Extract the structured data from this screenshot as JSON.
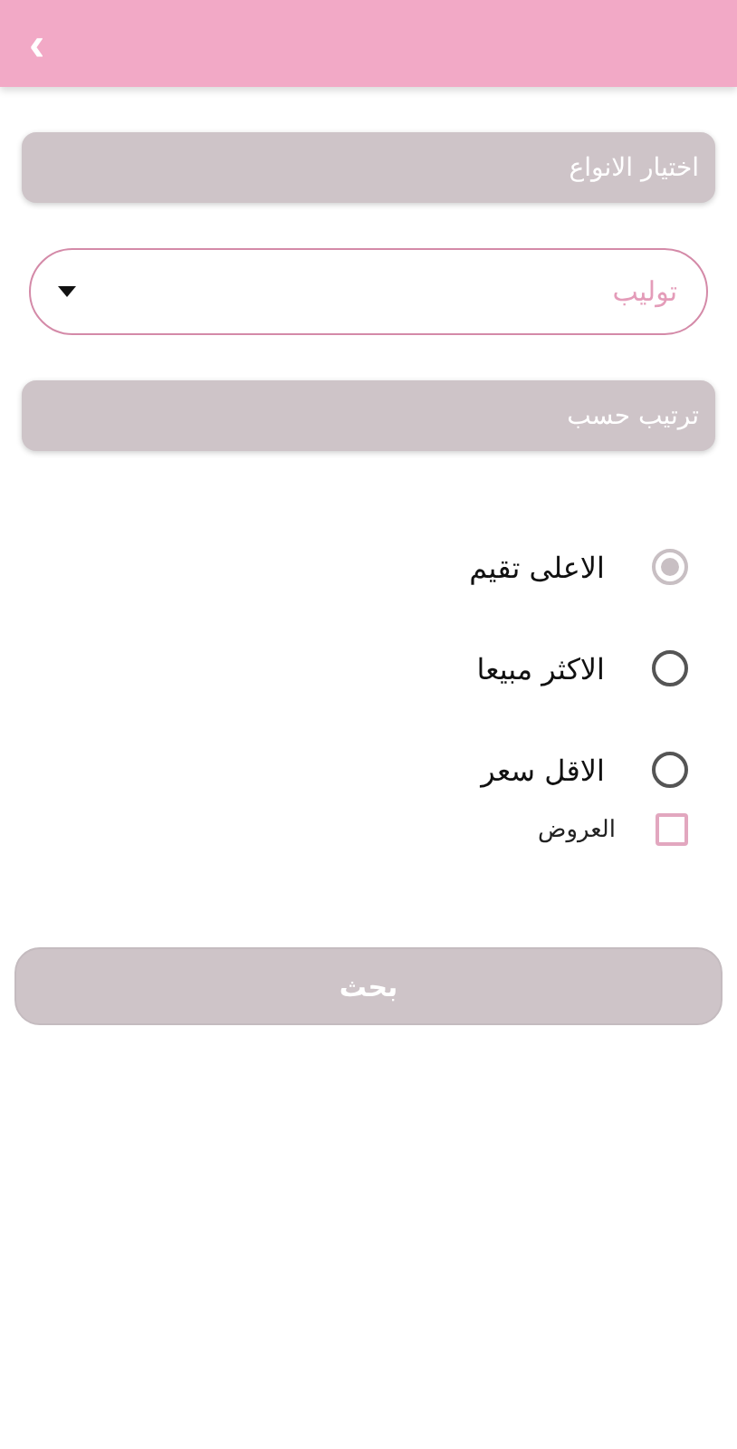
{
  "header": {
    "back": "‹"
  },
  "types_section": {
    "title": "اختيار الانواع"
  },
  "type_dropdown": {
    "value": "توليب"
  },
  "sort_section": {
    "title": "ترتيب حسب"
  },
  "sort_options": [
    {
      "label": "الاعلى تقيم",
      "selected": true
    },
    {
      "label": "الاكثر مبيعا",
      "selected": false
    },
    {
      "label": "الاقل سعر",
      "selected": false
    }
  ],
  "offers": {
    "label": "العروض",
    "checked": false
  },
  "search_button": {
    "label": "بحث"
  }
}
